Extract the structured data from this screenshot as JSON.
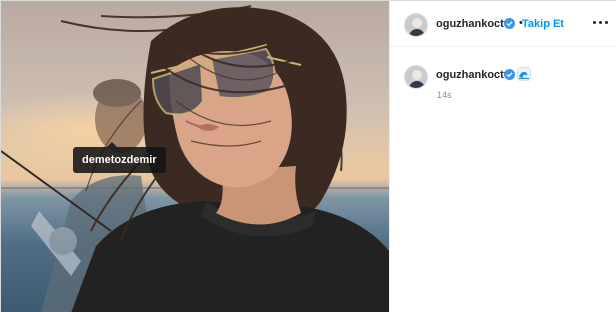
{
  "post": {
    "image_alt": "Photo of a woman with windblown hair wearing aviator sunglasses on a boat at sunset",
    "tag_label": "demetozdemir"
  },
  "header": {
    "username": "oguzhankoctv",
    "separator": "•",
    "follow_label": "Takip Et"
  },
  "caption": {
    "username": "oguzhankoctv",
    "emoji": "wave-emoji",
    "time": "14s"
  },
  "colors": {
    "accent": "#0095f6",
    "verified": "#3897f0",
    "text": "#262626",
    "muted": "#8e8e8e"
  },
  "icons": [
    "verified-badge-icon",
    "more-options-icon",
    "wave-emoji"
  ]
}
